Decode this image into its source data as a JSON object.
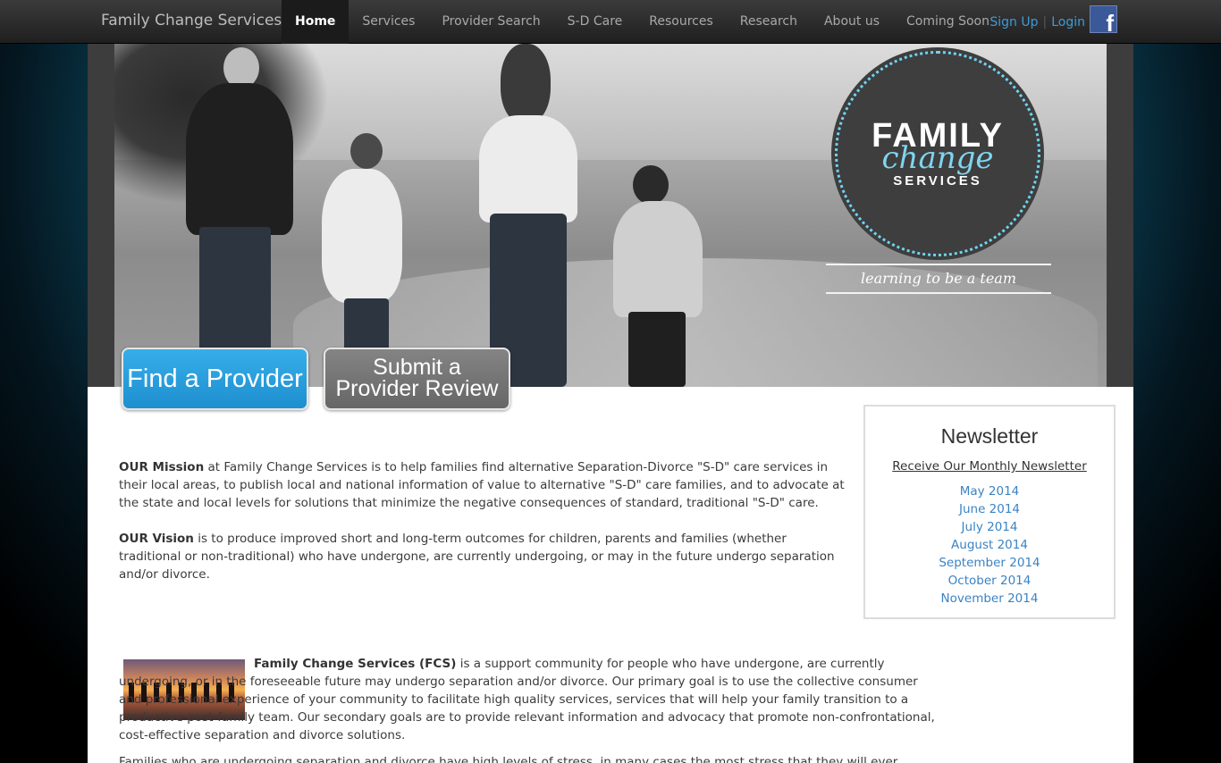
{
  "navbar": {
    "brand": "Family Change Services",
    "items": [
      {
        "label": "Home",
        "active": true
      },
      {
        "label": "Services"
      },
      {
        "label": "Provider Search"
      },
      {
        "label": "S-D Care"
      },
      {
        "label": "Resources"
      },
      {
        "label": "Research"
      },
      {
        "label": "About us"
      },
      {
        "label": "Coming Soon"
      }
    ],
    "sign_up": "Sign Up",
    "separator": "|",
    "login": "Login",
    "facebook_glyph": "f"
  },
  "hero": {
    "logo_family": "FAMILY",
    "logo_change": "change",
    "logo_services": "SERVICES",
    "tagline": "learning to be a team",
    "find_provider": "Find a Provider",
    "submit_review_line1": "Submit a",
    "submit_review_line2": "Provider Review"
  },
  "mission": {
    "lead": "OUR Mission",
    "text": " at Family Change Services is to help families find alternative Separation-Divorce \"S-D\" care services in their local areas, to publish local and national information of value to alternative \"S-D\" care families, and to advocate at the state and local levels for solutions that minimize the negative consequences of standard, traditional \"S-D\" care."
  },
  "vision": {
    "lead": "OUR Vision",
    "text": " is to produce improved short and long-term outcomes for children, parents and families (whether traditional or non-traditional) who have undergone, are currently undergoing, or may in the future undergo separation and/or divorce."
  },
  "newsletter": {
    "title": "Newsletter",
    "subtitle": "Receive Our Monthly Newsletter",
    "issues": [
      "May 2014",
      "June 2014",
      "July 2014",
      "August 2014",
      "September 2014",
      "October 2014",
      "November 2014"
    ]
  },
  "fcs": {
    "lead": "Family Change Services (FCS)",
    "text": " is a support community for people who have undergone, are currently undergoing, or in the foreseeable future may undergo separation and/or divorce. Our primary goal is to use the collective consumer and professional experience of your community to facilitate high quality services, services that will help your family transition to a productive post-family team. Our secondary goals are to provide relevant information and advocacy that promote non-confrontational, cost-effective separation and divorce solutions.",
    "families": "Families who are undergoing separation and divorce have high levels of stress, in many cases the most stress that they will ever experience in their"
  },
  "colors": {
    "accent": "#3d9bd8",
    "find_button": "#2aa0e0",
    "review_button": "#747474"
  }
}
